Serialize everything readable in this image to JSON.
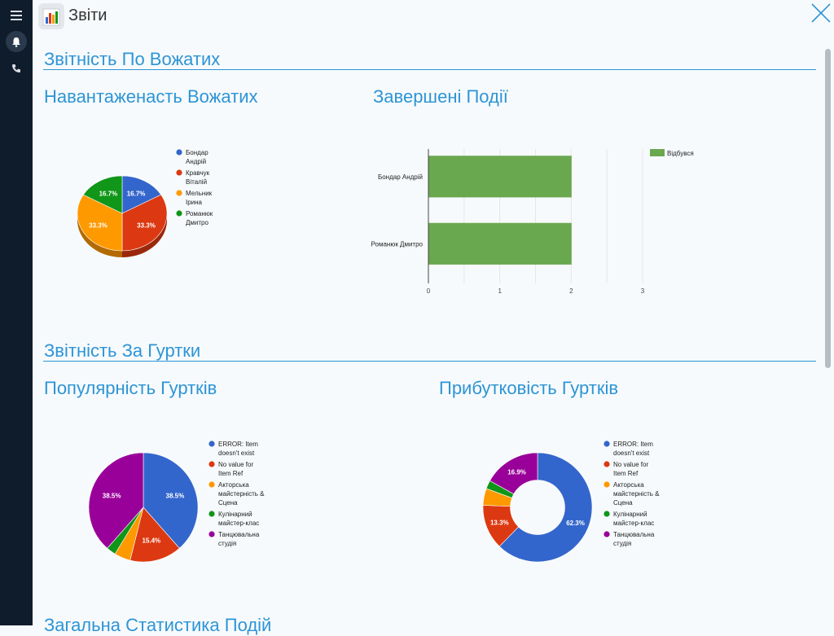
{
  "app": {
    "title": "Звіти",
    "icon": "bar-chart-icon"
  },
  "sidebar": {
    "icons": [
      "menu-icon",
      "bell-icon",
      "phone-icon"
    ]
  },
  "topbar": {
    "close_icon": "close-icon"
  },
  "colors": {
    "accent": "#2d95d6",
    "sidebar": "#0f1c2b"
  },
  "sections": [
    {
      "title": "Звітність По Вожатих"
    },
    {
      "title": "Звітність За Гуртки"
    },
    {
      "title": "Загальна Статистика Подій"
    }
  ],
  "chart_data": [
    {
      "type": "pie",
      "title": "Навантаженасть Вожатих",
      "variant": "3d",
      "legend": "right",
      "labels": [
        "Бондар Андрій",
        "Кравчук Віталій",
        "Мельник Ірина",
        "Романюк Дмитро"
      ],
      "values": [
        16.7,
        33.3,
        33.3,
        16.7
      ],
      "value_labels": [
        "16.7%",
        "33.3%",
        "33.3%",
        "16.7%"
      ],
      "colors": [
        "#3366cc",
        "#dc3912",
        "#ff9900",
        "#109618"
      ]
    },
    {
      "type": "bar",
      "orientation": "horizontal",
      "title": "Завершені Події",
      "categories": [
        "Бондар Андрій",
        "Романюк Дмитро"
      ],
      "series": [
        {
          "name": "Відбувся",
          "values": [
            2,
            2
          ],
          "color": "#6aa84f"
        }
      ],
      "xlim": [
        0,
        3
      ],
      "xticks": [
        "0",
        "1",
        "2",
        "3"
      ],
      "grid": true,
      "legend": "top-right"
    },
    {
      "type": "pie",
      "title": "Популярність Гуртків",
      "legend": "right",
      "labels": [
        "ERROR: Item doesn't exist",
        "No value for Item Ref",
        "Акторська майстерність & Сцена",
        "Кулінарний майстер-клас",
        "Танцювальна студія"
      ],
      "values": [
        38.5,
        15.4,
        4.8,
        2.8,
        38.5
      ],
      "value_labels": [
        "38.5%",
        "15.4%",
        "",
        "",
        "38.5%"
      ],
      "colors": [
        "#3366cc",
        "#dc3912",
        "#ff9900",
        "#109618",
        "#990099"
      ]
    },
    {
      "type": "pie",
      "variant": "donut",
      "title": "Прибутковість Гуртків",
      "legend": "right",
      "labels": [
        "ERROR: Item doesn't exist",
        "No value for Item Ref",
        "Акторська майстерність & Сцена",
        "Кулінарний майстер-клас",
        "Танцювальна студія"
      ],
      "values": [
        62.3,
        13.3,
        5.0,
        2.5,
        16.9
      ],
      "value_labels": [
        "62.3%",
        "13.3%",
        "",
        "",
        "16.9%"
      ],
      "colors": [
        "#3366cc",
        "#dc3912",
        "#ff9900",
        "#109618",
        "#990099"
      ]
    }
  ]
}
